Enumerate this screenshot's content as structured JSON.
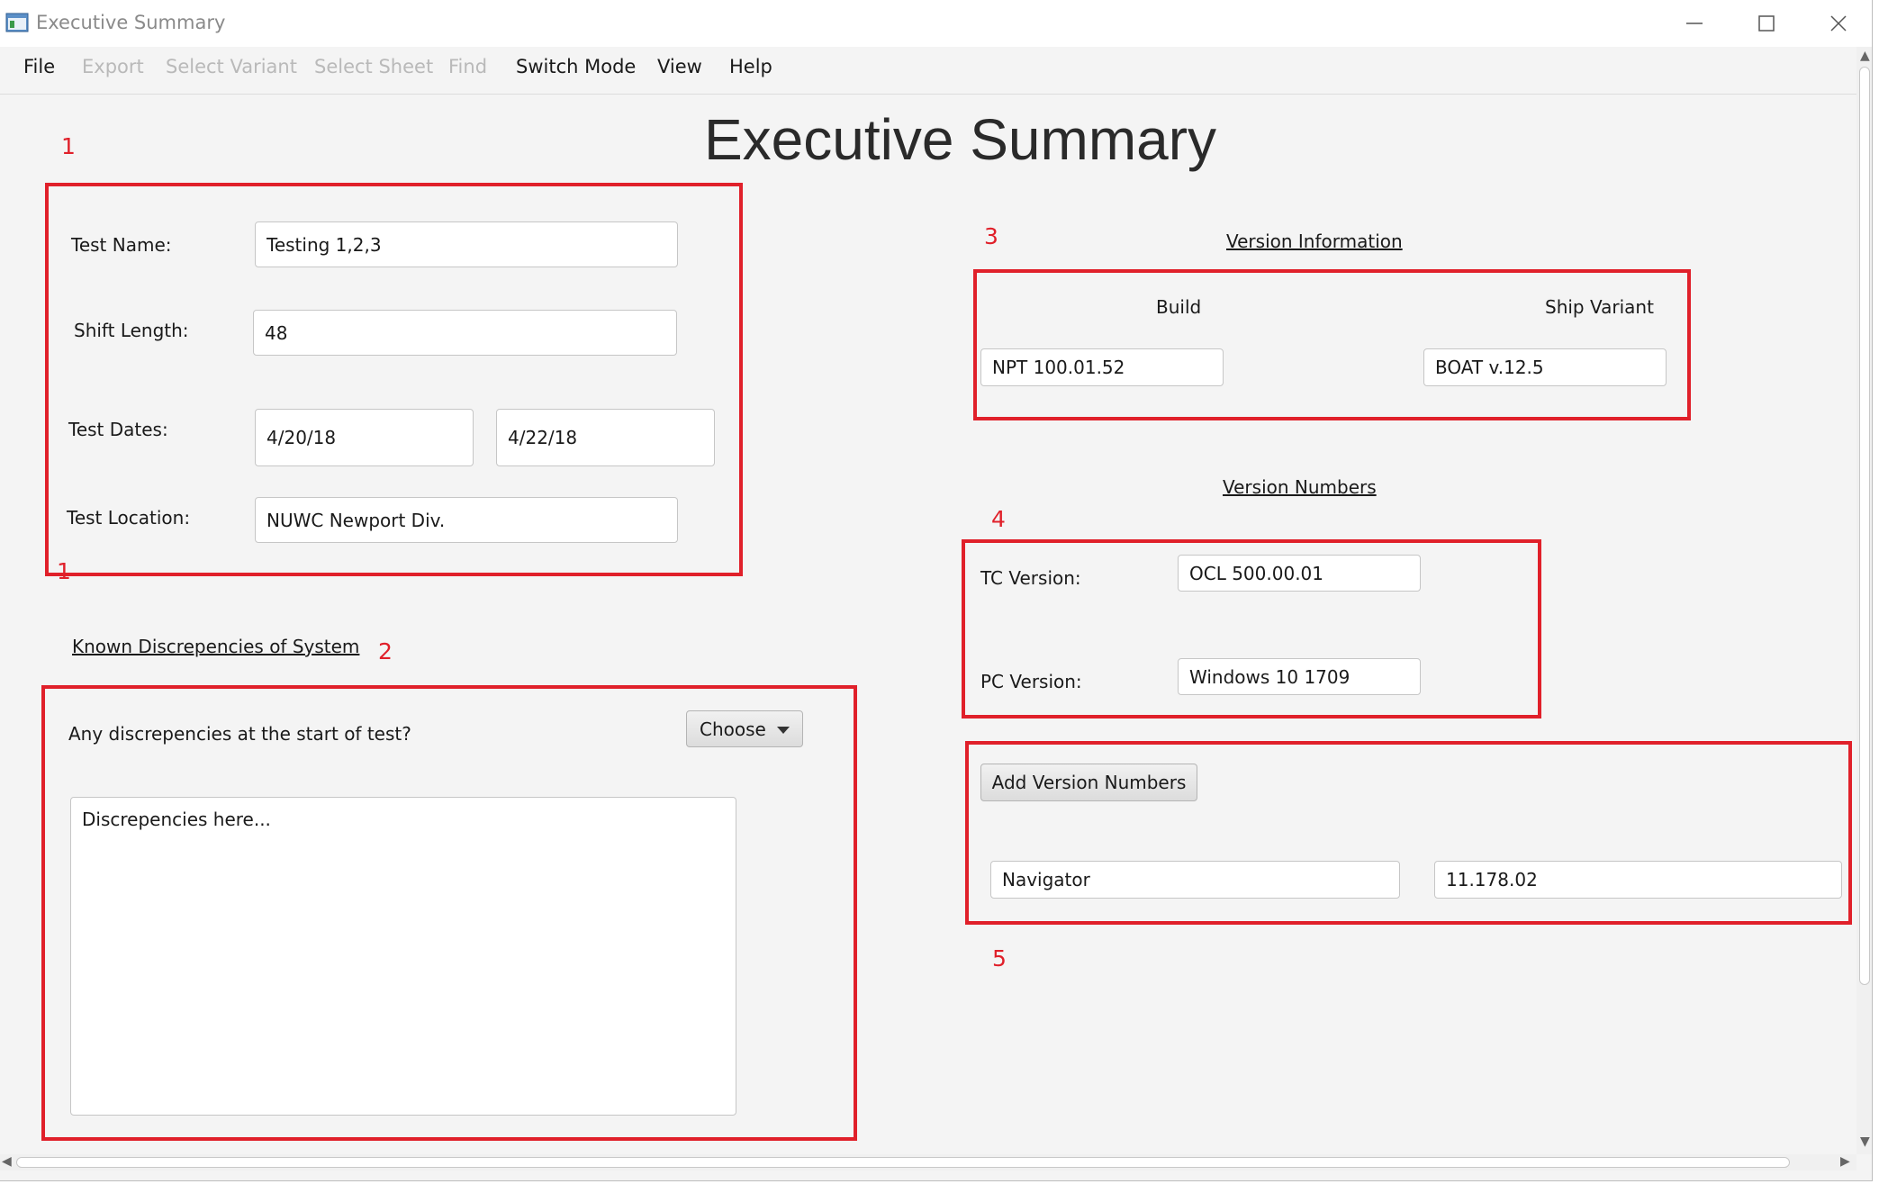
{
  "window": {
    "title": "Executive Summary"
  },
  "menu": {
    "items": [
      {
        "label": "File",
        "enabled": true
      },
      {
        "label": "Export",
        "enabled": false
      },
      {
        "label": "Select Variant",
        "enabled": false
      },
      {
        "label": "Select Sheet",
        "enabled": false
      },
      {
        "label": "Find",
        "enabled": false
      },
      {
        "label": "Switch Mode",
        "enabled": true
      },
      {
        "label": "View",
        "enabled": true
      },
      {
        "label": "Help",
        "enabled": true
      }
    ]
  },
  "page": {
    "title": "Executive Summary"
  },
  "annotations": {
    "color": "#e0202a",
    "markers": [
      "1",
      "1",
      "2",
      "3",
      "4",
      "5"
    ]
  },
  "test_info": {
    "test_name_label": "Test Name:",
    "test_name_value": "Testing 1,2,3",
    "shift_length_label": "Shift Length:",
    "shift_length_value": "48",
    "test_dates_label": "Test Dates:",
    "start_date": "4/20/18",
    "end_date": "4/22/18",
    "test_location_label": "Test Location:",
    "test_location_value": "NUWC Newport Div."
  },
  "discrepancies": {
    "heading": "Known Discrepencies of System",
    "question": "Any discrepencies at the start of test?",
    "dropdown_label": "Choose",
    "textarea_placeholder": "Discrepencies here..."
  },
  "version_information": {
    "heading": "Version Information",
    "build_label": "Build",
    "build_value": "NPT 100.01.52",
    "ship_variant_label": "Ship Variant",
    "ship_variant_value": "BOAT v.12.5"
  },
  "version_numbers": {
    "heading": "Version Numbers",
    "tc_label": "TC Version:",
    "tc_value": "OCL 500.00.01",
    "pc_label": "PC Version:",
    "pc_value": "Windows 10 1709"
  },
  "additional_versions": {
    "add_button_label": "Add Version Numbers",
    "name_value": "Navigator",
    "version_value": "11.178.02"
  }
}
